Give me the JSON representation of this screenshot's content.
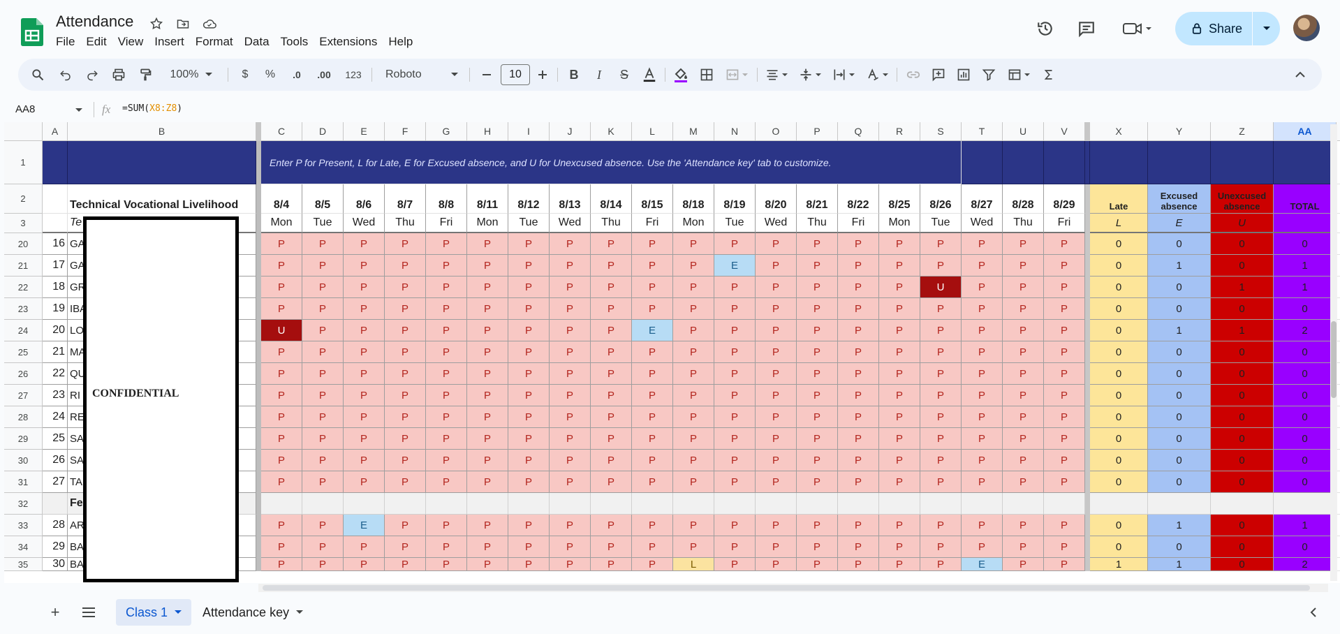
{
  "app": {
    "doc_title": "Attendance",
    "menu": [
      "File",
      "Edit",
      "View",
      "Insert",
      "Format",
      "Data",
      "Tools",
      "Extensions",
      "Help"
    ],
    "share_label": "Share"
  },
  "toolbar": {
    "zoom": "100%",
    "currency": "$",
    "percent": "%",
    "dec_decrease": ".0",
    "dec_increase": ".00",
    "number_format": "123",
    "font": "Roboto",
    "font_size": "10"
  },
  "formula_bar": {
    "name_box": "AA8",
    "formula_prefix": "=SUM(",
    "formula_ref": "X8:Z8",
    "formula_suffix": ")"
  },
  "columns": [
    "A",
    "B",
    "C",
    "D",
    "E",
    "F",
    "G",
    "H",
    "I",
    "J",
    "K",
    "L",
    "M",
    "N",
    "O",
    "P",
    "Q",
    "R",
    "S",
    "T",
    "U",
    "V",
    "X",
    "Y",
    "Z",
    "AA"
  ],
  "banner": "Enter P for Present, L for Late, E for Excused absence, and U for Unexcused absence. Use the 'Attendance key' tab to customize.",
  "class_title": "Technical Vocational Livelihood",
  "class_sub": "Te",
  "dates": [
    "8/4",
    "8/5",
    "8/6",
    "8/7",
    "8/8",
    "8/11",
    "8/12",
    "8/13",
    "8/14",
    "8/15",
    "8/18",
    "8/19",
    "8/20",
    "8/21",
    "8/22",
    "8/25",
    "8/26",
    "8/27",
    "8/28",
    "8/29"
  ],
  "days": [
    "Mon",
    "Tue",
    "Wed",
    "Thu",
    "Fri",
    "Mon",
    "Tue",
    "Wed",
    "Thu",
    "Fri",
    "Mon",
    "Tue",
    "Wed",
    "Thu",
    "Fri",
    "Mon",
    "Tue",
    "Wed",
    "Thu",
    "Fri"
  ],
  "summary_headers": {
    "late": "Late",
    "excused": "Excused absence",
    "unexcused": "Unexcused absence",
    "total": "TOTAL",
    "late_key": "L",
    "excused_key": "E",
    "unexcused_key": "U"
  },
  "header_rows": [
    "1",
    "2",
    "3"
  ],
  "rows": [
    {
      "row": "20",
      "num": "16",
      "name": "GA",
      "marks": "PPPPPPPPPPPPPPPPPPPP",
      "late": "0",
      "exc": "0",
      "unx": "0",
      "tot": "0"
    },
    {
      "row": "21",
      "num": "17",
      "name": "GA",
      "marks": "PPPPPPPPPPPEPPPPPPPP",
      "late": "0",
      "exc": "1",
      "unx": "0",
      "tot": "1"
    },
    {
      "row": "22",
      "num": "18",
      "name": "GR",
      "marks": "PPPPPPPPPPPPPPPPUPPP",
      "late": "0",
      "exc": "0",
      "unx": "1",
      "tot": "1"
    },
    {
      "row": "23",
      "num": "19",
      "name": "IBA",
      "marks": "PPPPPPPPPPPPPPPPPPPP",
      "late": "0",
      "exc": "0",
      "unx": "0",
      "tot": "0"
    },
    {
      "row": "24",
      "num": "20",
      "name": "LO",
      "marks": "UPPPPPPPPEPPPPPPPPPP",
      "late": "0",
      "exc": "1",
      "unx": "1",
      "tot": "2"
    },
    {
      "row": "25",
      "num": "21",
      "name": "MA",
      "marks": "PPPPPPPPPPPPPPPPPPPP",
      "late": "0",
      "exc": "0",
      "unx": "0",
      "tot": "0"
    },
    {
      "row": "26",
      "num": "22",
      "name": "QU",
      "marks": "PPPPPPPPPPPPPPPPPPPP",
      "late": "0",
      "exc": "0",
      "unx": "0",
      "tot": "0"
    },
    {
      "row": "27",
      "num": "23",
      "name": "RI",
      "marks": "PPPPPPPPPPPPPPPPPPPP",
      "late": "0",
      "exc": "0",
      "unx": "0",
      "tot": "0"
    },
    {
      "row": "28",
      "num": "24",
      "name": "RE",
      "marks": "PPPPPPPPPPPPPPPPPPPP",
      "late": "0",
      "exc": "0",
      "unx": "0",
      "tot": "0"
    },
    {
      "row": "29",
      "num": "25",
      "name": "SA",
      "marks": "PPPPPPPPPPPPPPPPPPPP",
      "late": "0",
      "exc": "0",
      "unx": "0",
      "tot": "0"
    },
    {
      "row": "30",
      "num": "26",
      "name": "SA",
      "marks": "PPPPPPPPPPPPPPPPPPPP",
      "late": "0",
      "exc": "0",
      "unx": "0",
      "tot": "0"
    },
    {
      "row": "31",
      "num": "27",
      "name": "TA",
      "marks": "PPPPPPPPPPPPPPPPPPPP",
      "late": "0",
      "exc": "0",
      "unx": "0",
      "tot": "0"
    },
    {
      "row": "32",
      "num": "",
      "name": "Fe",
      "marks": "",
      "late": "",
      "exc": "",
      "unx": "",
      "tot": "",
      "section": true
    },
    {
      "row": "33",
      "num": "28",
      "name": "AR",
      "marks": "PPEPPPPPPPPPPPPPPPPP",
      "late": "0",
      "exc": "1",
      "unx": "0",
      "tot": "1"
    },
    {
      "row": "34",
      "num": "29",
      "name": "BA",
      "marks": "PPPPPPPPPPPPPPPPPPPP",
      "late": "0",
      "exc": "0",
      "unx": "0",
      "tot": "0"
    },
    {
      "row": "35",
      "num": "30",
      "name": "BA",
      "marks": "PPPPPPPPPPLPPPPPPEPPP",
      "late": "1",
      "exc": "1",
      "unx": "0",
      "tot": "2"
    }
  ],
  "confidential": "CONFIDENTIAL",
  "sheet_tabs": [
    {
      "label": "Class 1",
      "active": true
    },
    {
      "label": "Attendance key",
      "active": false
    }
  ]
}
